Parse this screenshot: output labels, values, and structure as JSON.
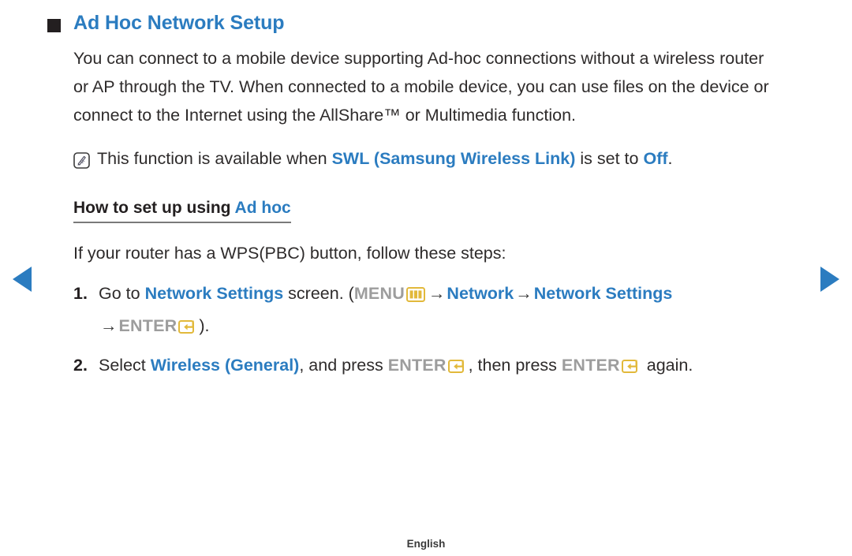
{
  "document": {
    "title": "Ad Hoc Network Setup",
    "footer_language": "English"
  },
  "colors": {
    "accent_blue": "#2b7cc0",
    "key_gray": "#9d9d9d",
    "key_gold": "#e2b93b",
    "body_text": "#2e2b2b",
    "bullet": "#231f20"
  },
  "nav": {
    "prev_label": "Previous page",
    "next_label": "Next page"
  },
  "intro": {
    "paragraph": "You can connect to a mobile device supporting Ad-hoc connections without a wireless router or AP through the TV. When connected to a mobile device, you can use files on the device or connect to the Internet using the AllShare™ or Multimedia function."
  },
  "note": {
    "icon": "note-icon",
    "text_before": "This function is available when ",
    "highlight_1": "SWL (Samsung Wireless Link)",
    "text_middle": " is set to ",
    "highlight_2": "Off",
    "text_after": "."
  },
  "section": {
    "heading_plain": "How to set up using ",
    "heading_accent": "Ad hoc",
    "lead": "If your router has a WPS(PBC) button, follow these steps:"
  },
  "steps": [
    {
      "number": "1.",
      "seg_1": "Go to ",
      "seg_2_blue": "Network Settings",
      "seg_3": " screen. (",
      "seg_4_gray": "MENU",
      "icon_1": "menu-icon",
      "seg_5_arrow": "→",
      "seg_6_blue": "Network",
      "seg_7_arrow": "→",
      "seg_8_blue": "Network Settings",
      "seg_9_arrow": "→",
      "seg_10_gray": "ENTER",
      "icon_2": "enter-icon",
      "seg_11": ")."
    },
    {
      "number": "2.",
      "seg_1": "Select ",
      "seg_2_blue": "Wireless (General)",
      "seg_3": ", and press ",
      "seg_4_gray": "ENTER",
      "icon_1": "enter-icon",
      "seg_5": ", then press ",
      "seg_6_gray": "ENTER",
      "icon_2": "enter-icon",
      "seg_7": " again."
    }
  ]
}
